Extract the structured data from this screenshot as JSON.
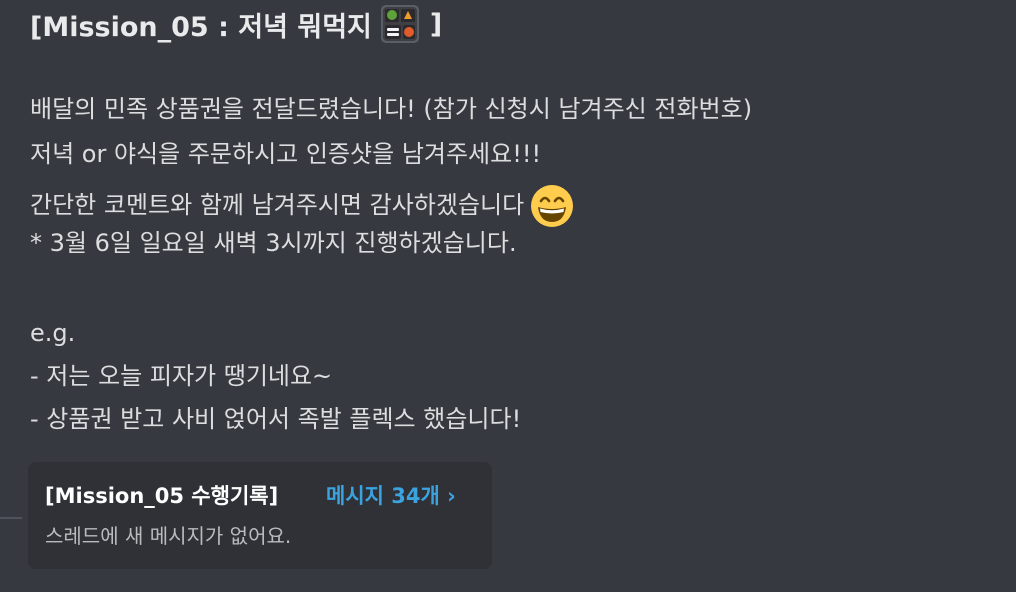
{
  "message": {
    "heading_text": "[Mission_05 : 저녁 뭐먹지",
    "heading_close": "]",
    "heading_emoji": "bento-box-icon",
    "lines": [
      "배달의 민족 상품권을 전달드렸습니다! (참가 신청시 남겨주신 전화번호)",
      "저녁 or 야식을 주문하시고 인증샷을 남겨주세요!!!",
      "간단한 코멘트와 함께 남겨주시면 감사하겠습니다",
      "* 3월 6일 일요일 새벽 3시까지 진행하겠습니다.",
      "e.g.",
      "- 저는 오늘 피자가 땡기네요~",
      "- 상품권 받고 사비 얹어서 족발 플렉스 했습니다!"
    ],
    "line3_emoji": "grinning-face-icon"
  },
  "thread": {
    "title": "[Mission_05 수행기록]",
    "link_label": "메시지 34개 ›",
    "subtitle": "스레드에 새 메시지가 없어요."
  },
  "colors": {
    "background": "#36393f",
    "thread_background": "#2f3136",
    "link": "#3aa3e0",
    "text": "#dcddde"
  }
}
